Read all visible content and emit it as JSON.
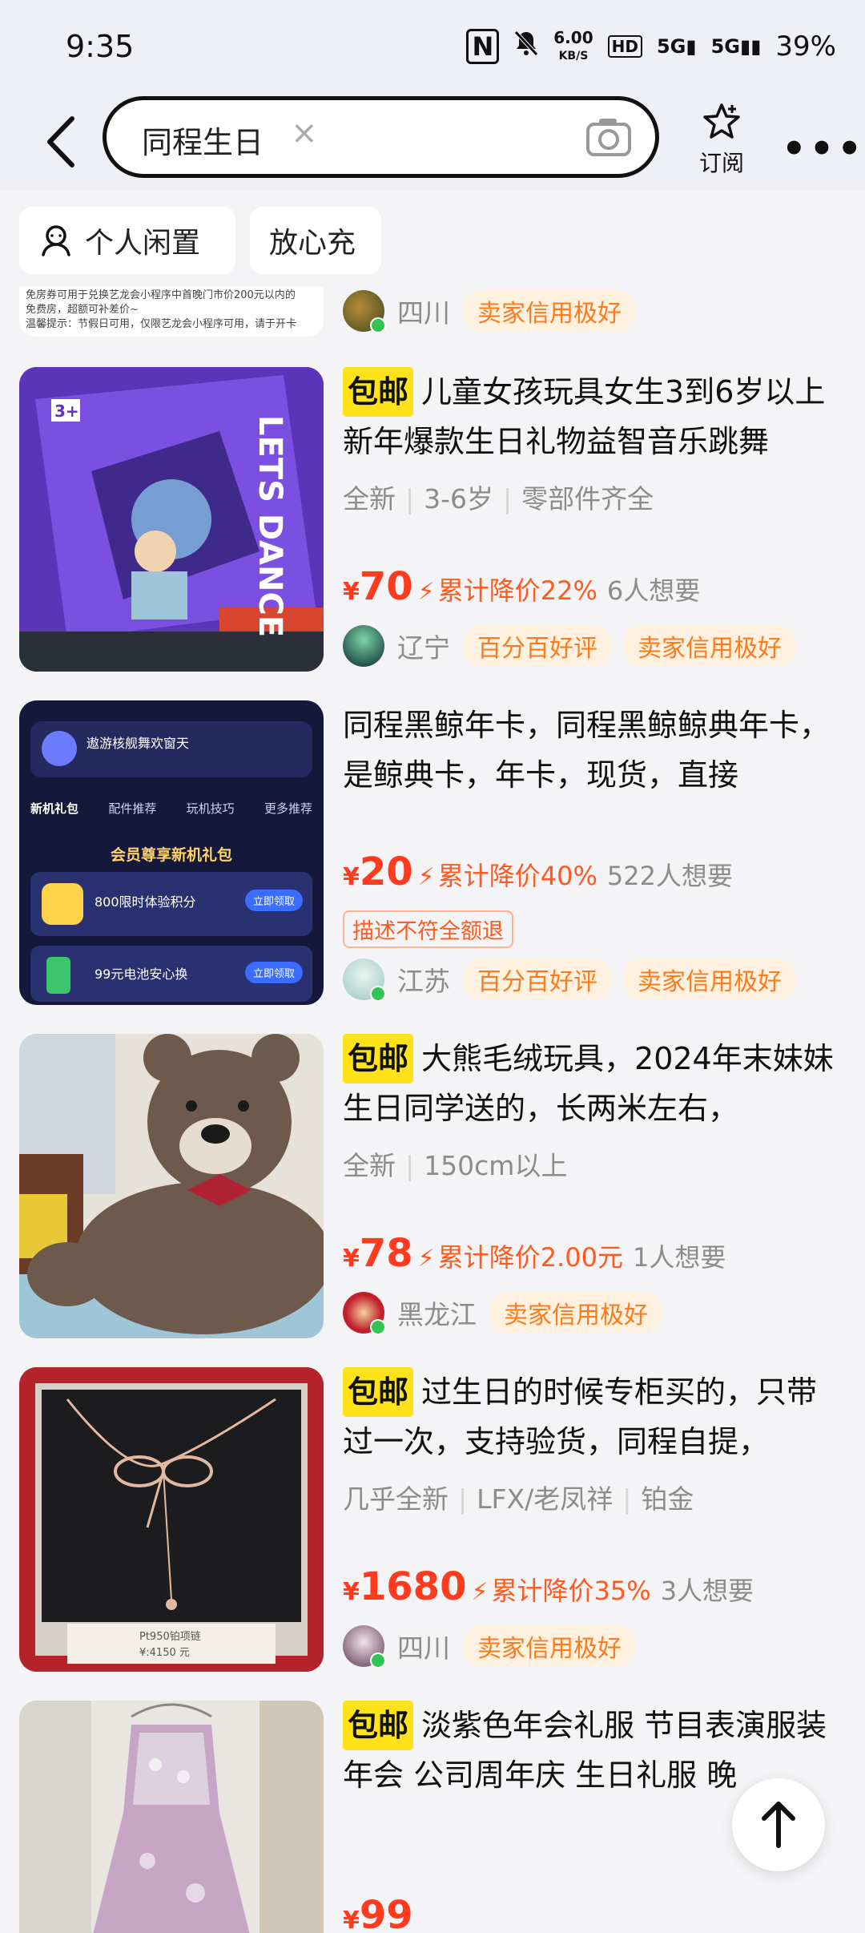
{
  "status_bar": {
    "time": "9:35",
    "net_speed_value": "6.00",
    "net_speed_unit": "KB/S",
    "hd_badge": "HD",
    "sig1": "5G",
    "sig2": "5G",
    "battery": "39%"
  },
  "header": {
    "search_query": "同程生日",
    "clear_symbol": "×",
    "subscribe_label": "订阅",
    "more_symbol": "•••"
  },
  "filters": [
    {
      "label": "个人闲置",
      "icon": "person-chat-icon"
    },
    {
      "label": "放心充"
    }
  ],
  "partial_item": {
    "thumb_text_line1": "免房券可用于兑换艺龙会小程序中首晚门市价200元以内的",
    "thumb_text_line2": "免费房，超额可补差价~",
    "thumb_text_line3": "温馨提示：节假日可用，仅限艺龙会小程序可用，请于开卡",
    "region": "四川",
    "badges": [
      "卖家信用极好"
    ]
  },
  "items": [
    {
      "free_shipping": "包邮",
      "title": "儿童女孩玩具女生3到6岁以上新年爆款生日礼物益智音乐跳舞",
      "tags": [
        "全新",
        "3-6岁",
        "零部件齐全"
      ],
      "yen": "¥",
      "price": "70",
      "drop": "累计降价22%",
      "wants": "6人想要",
      "region": "辽宁",
      "badges": [
        "百分百好评",
        "卖家信用极好"
      ],
      "thumb_text": "LETS DANCE",
      "thumb_badge": "3+"
    },
    {
      "title": "同程黑鲸年卡，同程黑鲸鲸典年卡，是鲸典卡，年卡，现货，直接",
      "yen": "¥",
      "price": "20",
      "drop": "累计降价40%",
      "wants": "522人想要",
      "warning": "描述不符全额退",
      "region": "江苏",
      "badges": [
        "百分百好评",
        "卖家信用极好"
      ],
      "thumb_lines": [
        "遨游核舰舞欢窗天",
        "新机礼包",
        "配件推荐",
        "玩机技巧",
        "更多推荐",
        "会员尊享新机礼包",
        "800限时体验积分",
        "立即领取",
        "99元电池安心换",
        "立即领取"
      ]
    },
    {
      "free_shipping": "包邮",
      "title": "大熊毛绒玩具，2024年末妹妹生日同学送的，长两米左右，",
      "tags": [
        "全新",
        "150cm以上"
      ],
      "yen": "¥",
      "price": "78",
      "drop": "累计降价2.00元",
      "wants": "1人想要",
      "region": "黑龙江",
      "badges": [
        "卖家信用极好"
      ]
    },
    {
      "free_shipping": "包邮",
      "title": "过生日的时候专柜买的，只带过一次，支持验货，同程自提，",
      "tags": [
        "几乎全新",
        "LFX/老凤祥",
        "铂金"
      ],
      "yen": "¥",
      "price": "1680",
      "drop": "累计降价35%",
      "wants": "3人想要",
      "region": "四川",
      "badges": [
        "卖家信用极好"
      ],
      "thumb_label": "Pt950铂项链",
      "thumb_price": "¥:4150 元"
    },
    {
      "free_shipping": "包邮",
      "title": "淡紫色年会礼服 节目表演服装 年会 公司周年庆 生日礼服 晚",
      "yen": "¥",
      "price": "99"
    }
  ],
  "colors": {
    "accent_price": "#ff3b1f",
    "free_ship_bg": "#ffe21a",
    "badge_text": "#ff7a1a",
    "badge_bg": "#fff1e0",
    "online_dot": "#31c452"
  }
}
